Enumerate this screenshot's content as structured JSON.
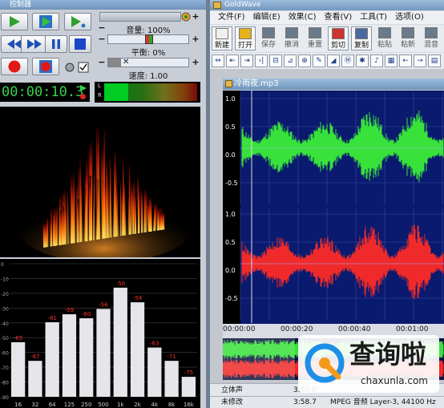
{
  "controller": {
    "title": "控制器",
    "volume_label": "音量: 100%",
    "volume_value": 1.0,
    "balance_label": "平衡: 0%",
    "balance_value": 0.0,
    "speed_label": "速度: 1.00",
    "time_display": "00:00:10.3",
    "meter_channels": [
      "L",
      "R"
    ],
    "eq_bands": [
      {
        "freq": "16",
        "value": "-65",
        "level": 0.41
      },
      {
        "freq": "32",
        "value": "-67",
        "level": 0.27
      },
      {
        "freq": "64",
        "value": "-61",
        "level": 0.56
      },
      {
        "freq": "125",
        "value": "-59",
        "level": 0.62
      },
      {
        "freq": "250",
        "value": "-60",
        "level": 0.59
      },
      {
        "freq": "500",
        "value": "-56",
        "level": 0.66
      },
      {
        "freq": "1k",
        "value": "-50",
        "level": 0.82
      },
      {
        "freq": "2k",
        "value": "-54",
        "level": 0.71
      },
      {
        "freq": "4k",
        "value": "-63",
        "level": 0.37
      },
      {
        "freq": "8k",
        "value": "-71",
        "level": 0.27
      },
      {
        "freq": "16k",
        "value": "-75",
        "level": 0.15
      }
    ],
    "db_ticks": [
      "0",
      "-10",
      "-20",
      "-30",
      "-40",
      "-50",
      "-60",
      "-70",
      "-80",
      "-90"
    ]
  },
  "goldwave": {
    "title": "GoldWave",
    "menu": [
      "文件(F)",
      "编辑(E)",
      "效果(C)",
      "查看(V)",
      "工具(T)",
      "选项(O)"
    ],
    "toolbar": [
      "新建",
      "打开",
      "保存",
      "撤消",
      "重置",
      "剪切",
      "复制",
      "粘贴",
      "粘新",
      "混音"
    ],
    "toolbar_active": [
      true,
      true,
      false,
      false,
      false,
      true,
      true,
      false,
      false,
      false
    ],
    "doc_title": "冷雨夜.mp3",
    "y_ticks": [
      "1.0",
      "0.5",
      "0.0",
      "-0.5",
      "1.0",
      "0.5",
      "0.0",
      "-0.5"
    ],
    "time_ticks": [
      "00:00:00",
      "00:00:20",
      "00:00:40",
      "00:01:00"
    ],
    "status1": {
      "channel": "立体声",
      "length": "3:58.6"
    },
    "status2": {
      "modified": "未修改",
      "length": "3:58.7",
      "format": "MPEG 音频 Layer-3, 44100 Hz"
    }
  },
  "watermark": {
    "brand": "查询啦",
    "domain": "chaxunla.com"
  },
  "colors": {
    "left_channel": "#38e23a",
    "right_channel": "#f02a2a",
    "wave_bg": "#0a1a6e",
    "eq_bar": "#e6e6ea",
    "eq_label": "#ff3030"
  }
}
